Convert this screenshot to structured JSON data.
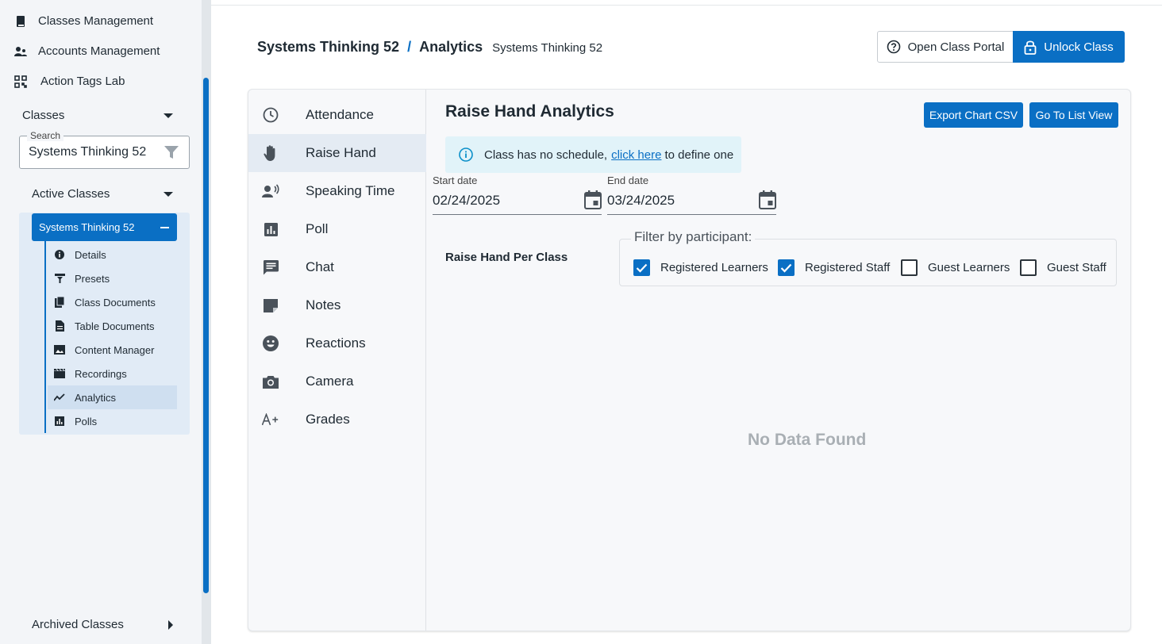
{
  "sidebar": {
    "top_nav": [
      {
        "label": "Classes Management",
        "icon": "book-icon"
      },
      {
        "label": "Accounts Management",
        "icon": "users-icon"
      },
      {
        "label": "Action Tags Lab",
        "icon": "qr-code-icon"
      }
    ],
    "classes_label": "Classes",
    "search": {
      "label": "Search",
      "value": "Systems Thinking 52"
    },
    "active_classes_label": "Active Classes",
    "selected_class": "Systems Thinking 52",
    "sub_items": [
      {
        "label": "Details",
        "icon": "info-icon"
      },
      {
        "label": "Presets",
        "icon": "presets-icon"
      },
      {
        "label": "Class Documents",
        "icon": "documents-icon"
      },
      {
        "label": "Table Documents",
        "icon": "document-icon"
      },
      {
        "label": "Content Manager",
        "icon": "image-icon"
      },
      {
        "label": "Recordings",
        "icon": "clapper-icon"
      },
      {
        "label": "Analytics",
        "icon": "trend-icon",
        "active": true
      },
      {
        "label": "Polls",
        "icon": "poll-icon"
      }
    ],
    "archived_classes_label": "Archived Classes"
  },
  "header": {
    "class_name": "Systems Thinking 52",
    "separator": "/",
    "section": "Analytics",
    "subtitle": "Systems Thinking 52",
    "open_portal_label": "Open Class Portal",
    "unlock_label": "Unlock Class"
  },
  "tabs": [
    {
      "label": "Attendance",
      "icon": "clock-icon"
    },
    {
      "label": "Raise Hand",
      "icon": "hand-icon",
      "active": true
    },
    {
      "label": "Speaking Time",
      "icon": "speaking-icon"
    },
    {
      "label": "Poll",
      "icon": "poll-icon"
    },
    {
      "label": "Chat",
      "icon": "chat-icon"
    },
    {
      "label": "Notes",
      "icon": "note-icon"
    },
    {
      "label": "Reactions",
      "icon": "smiley-icon"
    },
    {
      "label": "Camera",
      "icon": "camera-icon"
    },
    {
      "label": "Grades",
      "icon": "grade-icon"
    }
  ],
  "panel": {
    "title": "Raise Hand Analytics",
    "export_label": "Export Chart CSV",
    "list_view_label": "Go To List View",
    "alert": {
      "prefix": "Class has no schedule,",
      "link": "click here",
      "suffix": "to define one"
    },
    "start_date": {
      "label": "Start date",
      "value": "02/24/2025"
    },
    "end_date": {
      "label": "End date",
      "value": "03/24/2025"
    },
    "per_class_label": "Raise Hand Per Class",
    "filter": {
      "legend": "Filter by participant:",
      "options": [
        {
          "label": "Registered Learners",
          "checked": true
        },
        {
          "label": "Registered Staff",
          "checked": true
        },
        {
          "label": "Guest Learners",
          "checked": false
        },
        {
          "label": "Guest Staff",
          "checked": false
        }
      ]
    },
    "no_data": "No Data Found"
  },
  "colors": {
    "accent": "#0a6fc4",
    "alert_bg": "#e1f3f9"
  }
}
